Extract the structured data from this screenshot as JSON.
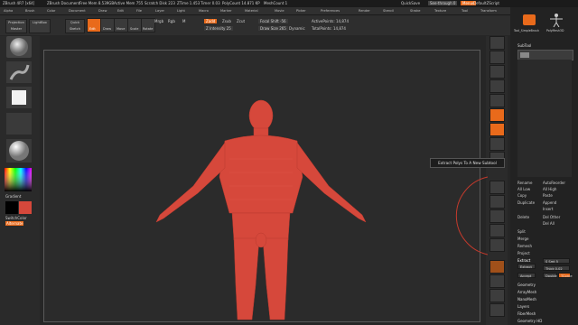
{
  "titlebar": {
    "app": "ZBrush 4R7 [x64]",
    "doc": "ZBrush Document",
    "free_mem": "Free Mem 8.539GB",
    "active_mem": "Active Mem 755",
    "scratch_disk": "Scratch Disk 223",
    "ztime": "ZTime 1.453",
    "timer": "Timer 0.03",
    "polycount": "PolyCount 14.871 KP",
    "meshcount": "MeshCount 1",
    "quicksave": "QuickSave",
    "see_through": "See-through 0",
    "menus": "Menus",
    "default_zscript": "DefaultZScript"
  },
  "menubar": [
    "Alpha",
    "Brush",
    "Color",
    "Document",
    "Draw",
    "Edit",
    "File",
    "Layer",
    "Light",
    "Macro",
    "Marker",
    "Material",
    "Movie",
    "Picker",
    "Preferences",
    "Render",
    "Stencil",
    "Stroke",
    "Texture",
    "Tool",
    "Transform",
    "Zplugin",
    "Zscript",
    "Help"
  ],
  "shelf": {
    "projection_master": "Projection Master",
    "lightbox": "LightBox",
    "quick_sketch": "Quick Sketch",
    "edit": "Edit",
    "draw": "Draw",
    "move": "Move",
    "scale": "Scale",
    "rotate": "Rotate",
    "mrgb": "Mrgb",
    "rgb": "Rgb",
    "m": "M",
    "zadd": "Zadd",
    "zsub": "Zsub",
    "zcut": "Zcut",
    "z_intensity": "Z Intensity 25",
    "focal_shift": "Focal Shift -56",
    "draw_size": "Draw Size 265",
    "dynamic": "Dynamic",
    "active_points": "ActivePoints: 14,874",
    "total_points": "TotalPoints: 14,874"
  },
  "lefttray": {
    "gradient": "Gradient",
    "switch_color": "SwitchColor",
    "alternate": "Alternate"
  },
  "tooltip": "Extract Polys To A New Subtool",
  "rightpanel": {
    "header_label": "SubTool",
    "toolnames": [
      "Tool_SimpleBrush",
      "PolyMesh3D"
    ],
    "rows": [
      {
        "label": "Rename",
        "value": "AutoReorder"
      },
      {
        "label": "All Low",
        "value": "All High"
      },
      {
        "label": "Copy",
        "value": "Paste"
      },
      {
        "label": "Duplicate",
        "value": "Append"
      },
      {
        "label": "",
        "value": "Insert"
      },
      {
        "label": "Delete",
        "value": "Del Other"
      },
      {
        "label": "",
        "value": "Del All"
      }
    ],
    "sections": [
      "Split",
      "Merge",
      "Remesh",
      "Project",
      "Extract"
    ],
    "extract": {
      "s_smt": "S Smt 5",
      "thick": "Thick 0.02",
      "accept": "Accept",
      "double": "Double",
      "tcorne": "TCorne"
    },
    "bottom": [
      "Geometry",
      "ArrayMesh",
      "NanoMesh",
      "Layers",
      "FiberMesh",
      "Geometry HD"
    ]
  },
  "colors": {
    "accent": "#e96a1b",
    "mesh": "#d6483b",
    "bg": "#262626"
  }
}
